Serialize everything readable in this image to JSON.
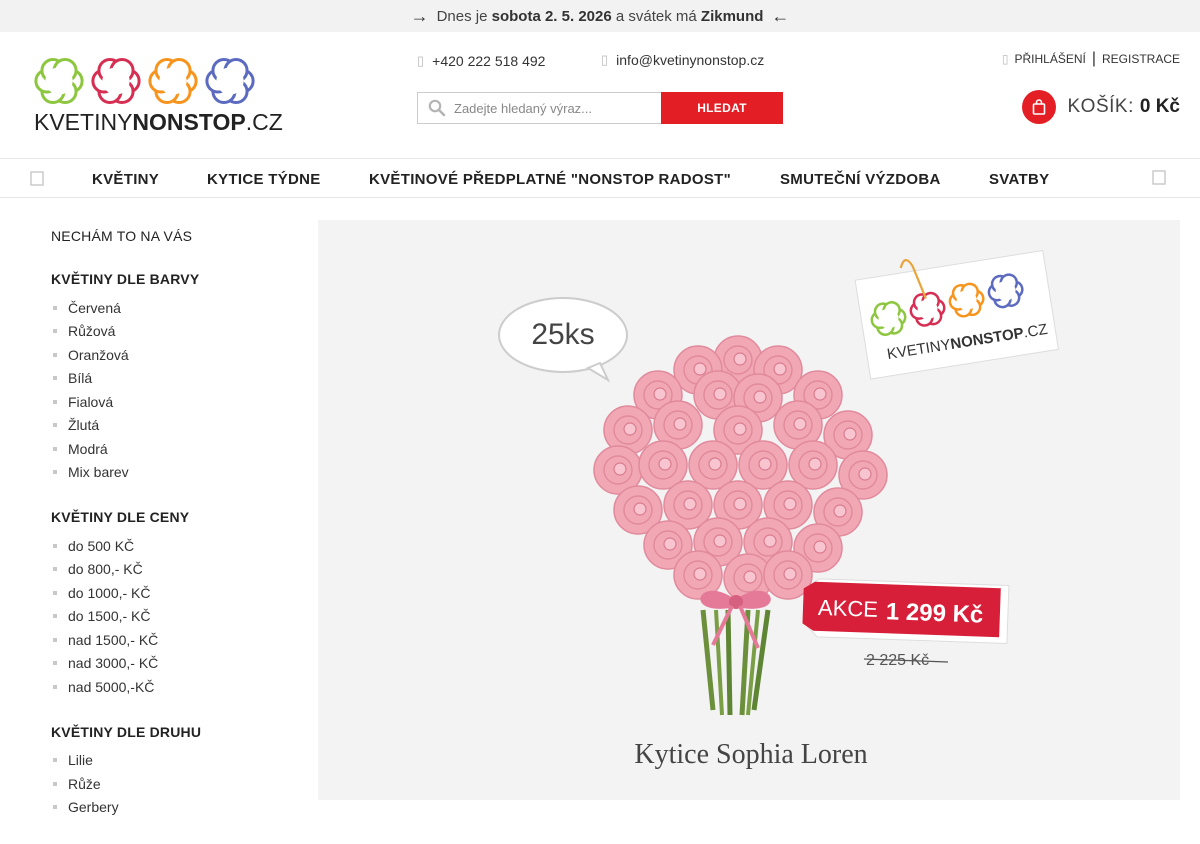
{
  "topbar": {
    "prefix": "Dnes je",
    "date": "sobota 2. 5. 2026",
    "middle": "a svátek má",
    "name": "Zikmund"
  },
  "logo": {
    "text_light": "KVETINY",
    "text_bold": "NONSTOP",
    "text_suffix": ".CZ",
    "flower_colors": [
      "#8dc63f",
      "#d62f53",
      "#f7941d",
      "#5c6bc0"
    ]
  },
  "contact": {
    "phone": "+420 222 518 492",
    "email": "info@kvetinynonstop.cz"
  },
  "search": {
    "placeholder": "Zadejte hledaný výraz...",
    "button": "HLEDAT"
  },
  "account": {
    "login": "PŘIHLÁŠENÍ",
    "register": "REGISTRACE"
  },
  "cart": {
    "label": "KOŠÍK:",
    "price": "0 Kč"
  },
  "nav": {
    "items": [
      "KVĚTINY",
      "KYTICE TÝDNE",
      "KVĚTINOVÉ PŘEDPLATNÉ \"NONSTOP RADOST\"",
      "SMUTEČNÍ VÝZDOBA",
      "SVATBY"
    ]
  },
  "sidebar": {
    "top_link": "NECHÁM TO NA VÁS",
    "sections": [
      {
        "heading": "KVĚTINY DLE BARVY",
        "items": [
          "Červená",
          "Růžová",
          "Oranžová",
          "Bílá",
          "Fialová",
          "Žlutá",
          "Modrá",
          "Mix barev"
        ]
      },
      {
        "heading": "KVĚTINY DLE CENY",
        "items": [
          "do 500 KČ",
          "do 800,- KČ",
          "do 1000,- KČ",
          "do 1500,- KČ",
          "nad 1500,- KČ",
          "nad 3000,- KČ",
          "nad 5000,-KČ"
        ]
      },
      {
        "heading": "KVĚTINY DLE DRUHU",
        "items": [
          "Lilie",
          "Růže",
          "Gerbery"
        ]
      }
    ]
  },
  "banner": {
    "count_bubble": "25ks",
    "tag_logo_light": "KVETINY",
    "tag_logo_bold": "NONSTOP",
    "tag_logo_suffix": ".CZ",
    "sale_label": "AKCE",
    "sale_price": "1 299 Kč",
    "old_price": "2 225 Kč",
    "product_name": "Kytice Sophia Loren",
    "accent_color": "#d71f3a",
    "rose_color": "#f2a7b5"
  }
}
